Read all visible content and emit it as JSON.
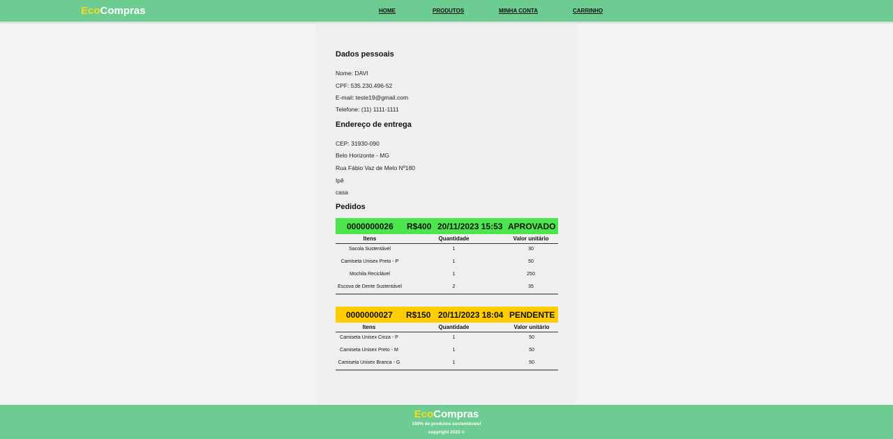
{
  "brand": {
    "eco": "Eco",
    "compras": "Compras"
  },
  "nav": {
    "home": "HOME",
    "produtos": "PRODUTOS",
    "minha_conta": "MINHA CONTA",
    "carrinho": "CARRINHO"
  },
  "dados": {
    "title": "Dados pessoais",
    "nome": "Nome: DAVI",
    "cpf": "CPF: 535.230.496-52",
    "email": "E-mail: teste19@gmail.com",
    "telefone": "Telefone: (11) 1111-1111"
  },
  "endereco": {
    "title": "Endereço de entrega",
    "cep": "CEP: 31930-090",
    "cidade": "Belo Horizonte - MG",
    "rua": "Rua Fábio Vaz de Melo Nº180",
    "bairro": "Ipê",
    "complemento": "casa"
  },
  "pedidos": {
    "title": "Pedidos",
    "columns": {
      "itens": "Itens",
      "quantidade": "Quantidade",
      "valor": "Valor unitário"
    },
    "orders": [
      {
        "id": "0000000026",
        "total": "R$400",
        "date": "20/11/2023 15:53",
        "status": "APROVADO",
        "status_color": "#4ce64c",
        "items": [
          {
            "name": "Sacola Sustentável",
            "qty": "1",
            "price": "30"
          },
          {
            "name": "Camiseta Unisex Preto - P",
            "qty": "1",
            "price": "50"
          },
          {
            "name": "Mochila Reciclável",
            "qty": "1",
            "price": "250"
          },
          {
            "name": "Escova de Dente Sustentável",
            "qty": "2",
            "price": "35"
          }
        ]
      },
      {
        "id": "0000000027",
        "total": "R$150",
        "date": "20/11/2023 18:04",
        "status": "PENDENTE",
        "status_color": "#ffcc00",
        "items": [
          {
            "name": "Camiseta Unisex Cinza - P",
            "qty": "1",
            "price": "50"
          },
          {
            "name": "Camiseta Unisex Preto - M",
            "qty": "1",
            "price": "50"
          },
          {
            "name": "Camiseta Unisex Branca - G",
            "qty": "1",
            "price": "50"
          }
        ]
      }
    ]
  },
  "footer": {
    "tagline": "100% de produtos sustentáveis!",
    "copyright": "copyright 2023 ©"
  },
  "colors": {
    "header_bg": "#6ccc91",
    "brand_eco": "#f5dd16"
  }
}
